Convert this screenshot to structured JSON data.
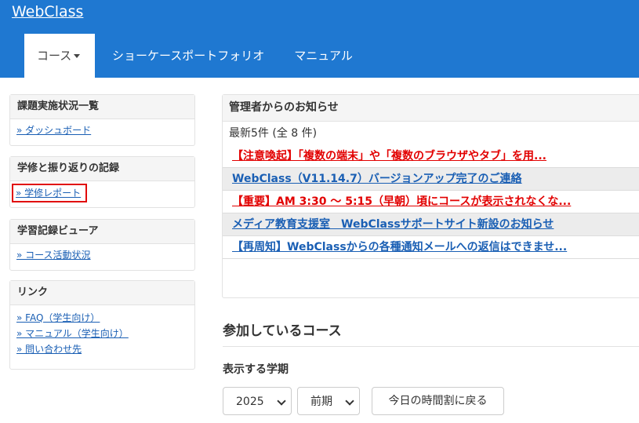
{
  "header": {
    "brand": "WebClass",
    "nav": [
      {
        "label": "コース"
      },
      {
        "label": "ショーケースポートフォリオ"
      },
      {
        "label": "マニュアル"
      }
    ]
  },
  "sidebar": {
    "panels": [
      {
        "title": "課題実施状況一覧",
        "links": [
          "» ダッシュボード"
        ]
      },
      {
        "title": "学修と振り返りの記録",
        "links": [
          "» 学修レポート"
        ]
      },
      {
        "title": "学習記録ビューア",
        "links": [
          "» コース活動状況"
        ]
      },
      {
        "title": "リンク",
        "links": [
          "» FAQ（学生向け）",
          "» マニュアル（学生向け）",
          "» 問い合わせ先"
        ]
      }
    ]
  },
  "notice": {
    "title": "管理者からのお知らせ",
    "count": "最新5件 (全 8 件)",
    "items": [
      "【注意喚起】「複数の端末」や「複数のブラウザやタブ」を用...",
      "WebClass（V11.14.7）バージョンアップ完了のご連絡",
      "【重要】AM 3:30 ～ 5:15（早朝）頃にコースが表示されなくな...",
      "メディア教育支援室　WebClassサポートサイト新設のお知らせ",
      "【再周知】WebClassからの各種通知メールへの返信はできませ..."
    ]
  },
  "courses": {
    "title": "参加しているコース",
    "term_label": "表示する学期",
    "year": "2025",
    "semester": "前期",
    "today_button": "今日の時間割に戻る"
  },
  "colors": {
    "header_bg": "#1f78d1",
    "link": "#1a5fb4",
    "alert_red": "#e20000",
    "highlight_border": "#e10b0b"
  }
}
